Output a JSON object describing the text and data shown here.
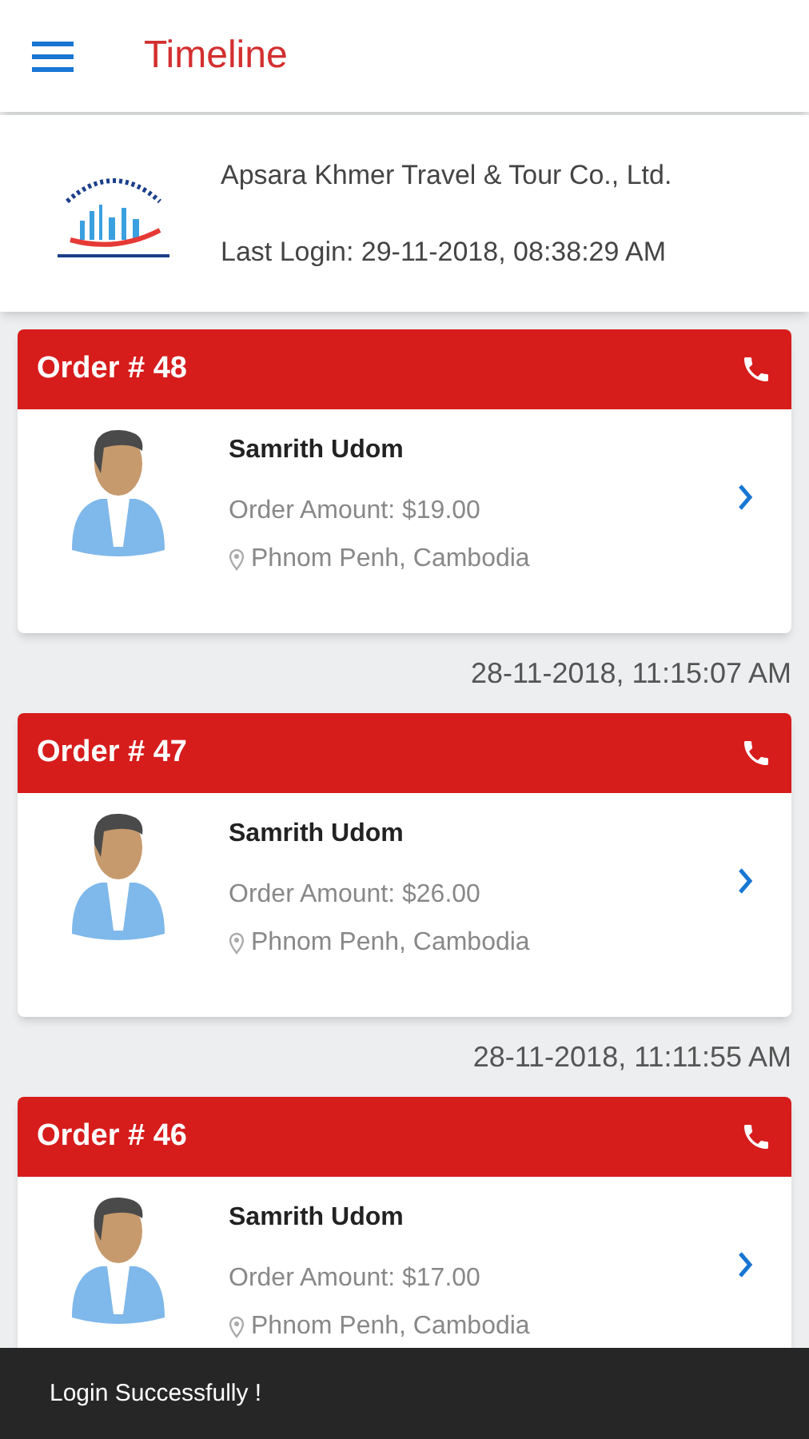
{
  "app_bar": {
    "title": "Timeline"
  },
  "company": {
    "name": "Apsara Khmer Travel & Tour Co., Ltd.",
    "last_login": "Last Login: 29-11-2018, 08:38:29 AM"
  },
  "orders": [
    {
      "title": "Order # 48",
      "customer": "Samrith Udom",
      "amount": "Order Amount: $19.00",
      "location": "Phnom Penh, Cambodia",
      "time": "28-11-2018, 11:15:07 AM"
    },
    {
      "title": "Order # 47",
      "customer": "Samrith Udom",
      "amount": "Order Amount: $26.00",
      "location": "Phnom Penh, Cambodia",
      "time": "28-11-2018, 11:11:55 AM"
    },
    {
      "title": "Order # 46",
      "customer": "Samrith Udom",
      "amount": "Order Amount: $17.00",
      "location": "Phnom Penh, Cambodia"
    }
  ],
  "toast": {
    "message": "Login Successfully !"
  }
}
